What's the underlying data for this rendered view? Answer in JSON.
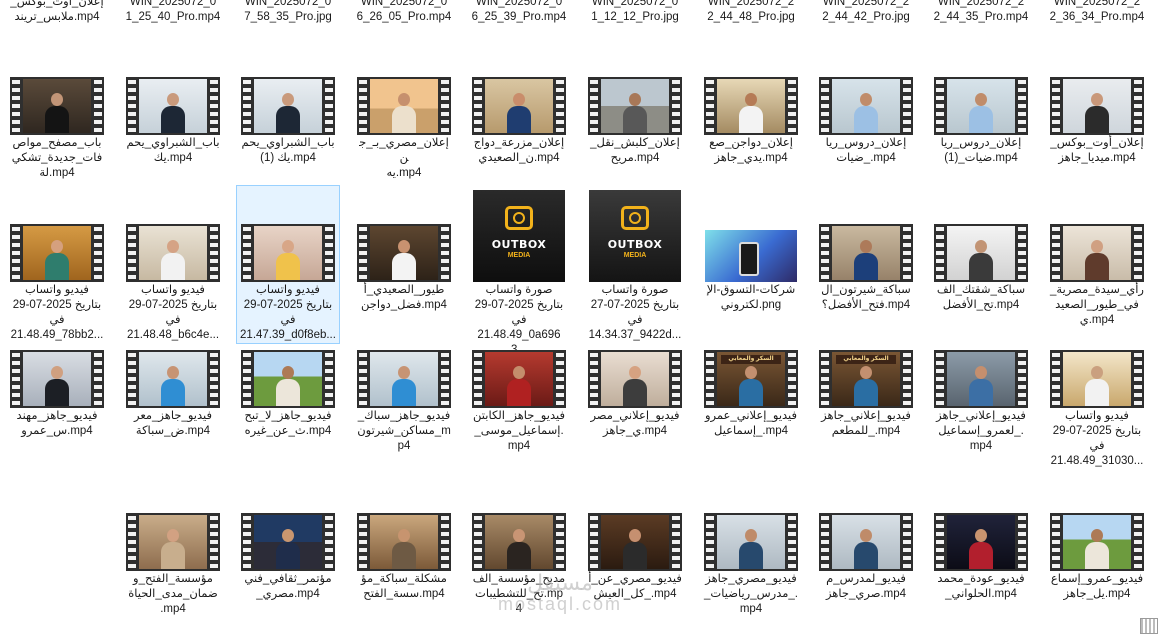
{
  "rows": [
    [
      {
        "name": "WIN_20250722_22_36_34_Pro.mp4",
        "label": "WIN_2025072_2\n2_36_34_Pro.mp4",
        "kind": "video",
        "scene": "none"
      },
      {
        "name": "WIN_20250722_22_44_35_Pro.mp4",
        "label": "WIN_2025072_2\n2_44_35_Pro.mp4",
        "kind": "video",
        "scene": "none"
      },
      {
        "name": "WIN_20250722_22_44_42_Pro.jpg",
        "label": "WIN_2025072_2\n2_44_42_Pro.jpg",
        "kind": "image",
        "scene": "none"
      },
      {
        "name": "WIN_20250722_22_44_48_Pro.jpg",
        "label": "WIN_2025072_2\n2_44_48_Pro.jpg",
        "kind": "image",
        "scene": "none"
      },
      {
        "name": "WIN_20250723_01_12_12_Pro.jpg",
        "label": "WIN_2025072_0\n1_12_12_Pro.jpg",
        "kind": "image",
        "scene": "none"
      },
      {
        "name": "WIN_20250724_06_25_39_Pro.mp4",
        "label": "WIN_2025072_0\n6_25_39_Pro.mp4",
        "kind": "video",
        "scene": "none"
      },
      {
        "name": "WIN_20250724_06_26_05_Pro.mp4",
        "label": "WIN_2025072_0\n6_26_05_Pro.mp4",
        "kind": "video",
        "scene": "none"
      },
      {
        "name": "WIN_20250726_07_58_35_Pro.jpg",
        "label": "WIN_2025072_0\n7_58_35_Pro.jpg",
        "kind": "image",
        "scene": "none"
      },
      {
        "name": "WIN_20250727_01_25_40_Pro.mp4",
        "label": "WIN_2025072_0\n1_25_40_Pro.mp4",
        "kind": "video",
        "scene": "none"
      },
      {
        "name": "إعلان أوت بوكس ملابس تريند.mp4",
        "label": "_إعلان_أوت_بوكس\nملابس_تريند.mp4",
        "kind": "video",
        "scene": "none"
      }
    ],
    [
      {
        "label": "_إعلان_أوت_بوكس\nميديا_جاهز.mp4",
        "kind": "video",
        "scene": "office_woman"
      },
      {
        "label": "إعلان_دروس_ريا\nضيات_(1).mp4",
        "kind": "video",
        "scene": "teacher"
      },
      {
        "label": "إعلان_دروس_ريا\nضيات_.mp4",
        "kind": "video",
        "scene": "teacher"
      },
      {
        "label": "إعلان_دواجن_صع\nيدي_جاهز.mp4",
        "kind": "video",
        "scene": "chef_white"
      },
      {
        "label": "_إعلان_كلبش_نقل\nمريح.mp4",
        "kind": "video",
        "scene": "street"
      },
      {
        "label": "إعلان_مزرعة_دواج\nن_الصعيدي.mp4",
        "kind": "video",
        "scene": "hijab_blue"
      },
      {
        "label": "إعلان_مصري_بـ_جن\nيه.mp4",
        "kind": "video",
        "scene": "pyramids"
      },
      {
        "label": "باب_الشبراوي_يحم\nيك (1).mp4",
        "kind": "video",
        "scene": "man_suit_bright"
      },
      {
        "label": "باب_الشبراوي_يحم\nيك.mp4",
        "kind": "video",
        "scene": "man_suit_bright"
      },
      {
        "label": "باب_مصفح_مواص\nفات_جديدة_تشكي\nلة.mp4",
        "kind": "video",
        "scene": "man_door"
      }
    ],
    [
      {
        "label": "_رأي_سيدة_مصرية\nفي_طيور_الصعيد\nي.mp4",
        "kind": "video",
        "scene": "woman_speaking"
      },
      {
        "label": "سباكة_شقتك_الف\nتح_الأفضل.mp4",
        "kind": "video",
        "scene": "kitchen"
      },
      {
        "label": "سباكة_شيرتون_ال\nفتح_الأفضل؟.mp4",
        "kind": "video",
        "scene": "plumber"
      },
      {
        "label": "شركات-التسوق-الإ\nلكتروني.png",
        "kind": "image_wide",
        "scene": "shopping"
      },
      {
        "label": "صورة واتساب\nبتاريخ 2025-07-27\nفي\n14.34.37_9422d...",
        "kind": "image",
        "scene": "outbox_studio"
      },
      {
        "label": "صورة واتساب\nبتاريخ 2025-07-29\nفي\n21.48.49_0a6963...",
        "kind": "image",
        "scene": "outbox_logo"
      },
      {
        "label": "طيور_الصعيدي_أ\nفضل_دواجن.mp4",
        "kind": "video",
        "scene": "chef_kitchen"
      },
      {
        "label": "فيديو واتساب\nبتاريخ 2025-07-29\nفي\n21.47.39_d0f8eb...",
        "kind": "video",
        "scene": "woman_store",
        "selected": true
      },
      {
        "label": "فيديو واتساب\nبتاريخ 2025-07-29\nفي\n21.48.48_b6c4e...",
        "kind": "video",
        "scene": "woman_home"
      },
      {
        "label": "فيديو واتساب\nبتاريخ 2025-07-29\nفي\n21.48.49_78bb2...",
        "kind": "video",
        "scene": "woman_warm"
      }
    ],
    [
      {
        "label": "فيديو واتساب\nبتاريخ 2025-07-29\nفي\n21.48.49_31030...",
        "kind": "video",
        "scene": "supermarket"
      },
      {
        "label": "فيديو_إعلاني_جاهز\nلعمرو_إسماعيل_.\nmp4",
        "kind": "video",
        "scene": "man_beard"
      },
      {
        "label": "فيديو_إعلاني_جاهز\nللمطعم_.mp4",
        "kind": "video",
        "scene": "restaurant",
        "sign": "السكر والمعابي"
      },
      {
        "label": "فيديو_إعلاني_عمرو\nإسماعيل_.mp4",
        "kind": "video",
        "scene": "restaurant",
        "sign": "السكر والمعابي"
      },
      {
        "label": "فيديو_إعلاني_مصر\nي_جاهز.mp4",
        "kind": "video",
        "scene": "woman_laugh"
      },
      {
        "label": "فيديو_جاهز_الكابتن\n_إسماعيل_موسى.\nmp4",
        "kind": "video",
        "scene": "crowd_red"
      },
      {
        "label": "_فيديو_جاهز_سباك\nمساكن_شيرتون_m\np4",
        "kind": "video",
        "scene": "plumber_blue"
      },
      {
        "label": "فيديو_جاهز_لا_تبح\nث_عن_غيره.mp4",
        "kind": "video",
        "scene": "farmer"
      },
      {
        "label": "فيديو_جاهز_معر\nض_سباكة.mp4",
        "kind": "video",
        "scene": "plumber_blue"
      },
      {
        "label": "فيديو_جاهز_مهند\nس_عمرو.mp4",
        "kind": "video",
        "scene": "woman_suit"
      }
    ],
    [
      {
        "label": "فيديو_عمرو_إسماع\nيل_جاهز.mp4",
        "kind": "video",
        "scene": "farmer"
      },
      {
        "label": "فيديو_عودة_محمد\n_الحلواني.mp4",
        "kind": "video",
        "scene": "boxer"
      },
      {
        "label": "فيديو_لمدرس_م\nصري_جاهز.mp4",
        "kind": "video",
        "scene": "classroom"
      },
      {
        "label": "فيديو_مصري_جاهز\n_مدرس_رياضيات_.\nmp4",
        "kind": "video",
        "scene": "classroom"
      },
      {
        "label": "فيديو_مصري_عن_أ\nكل_العيش_.mp4",
        "kind": "video",
        "scene": "man_smile"
      },
      {
        "label": "مديح_مؤسسة_الف\nتح_للتشطيبات.mp\n4",
        "kind": "video",
        "scene": "hijab_dark"
      },
      {
        "label": "مشكلة_سباكة_مؤ\nسسة_الفتح.mp4",
        "kind": "video",
        "scene": "living_room"
      },
      {
        "label": "مؤتمر_ثقافي_فني\n_مصري.mp4",
        "kind": "video",
        "scene": "conference"
      },
      {
        "label": "مؤسسة_الفتح_و\nضمان_مدى_الحياة\n.mp4",
        "kind": "video",
        "scene": "hijab_beige"
      }
    ]
  ],
  "logo": {
    "brand": "OUTBOX",
    "sub": "MEDIA"
  },
  "watermark": {
    "glyph": "مستقل",
    "text": "mostaql.com"
  },
  "colors": {
    "selection_border": "#99d1ff",
    "selection_fill": "#e5f3ff",
    "film_strip": "#2f2f2f"
  }
}
